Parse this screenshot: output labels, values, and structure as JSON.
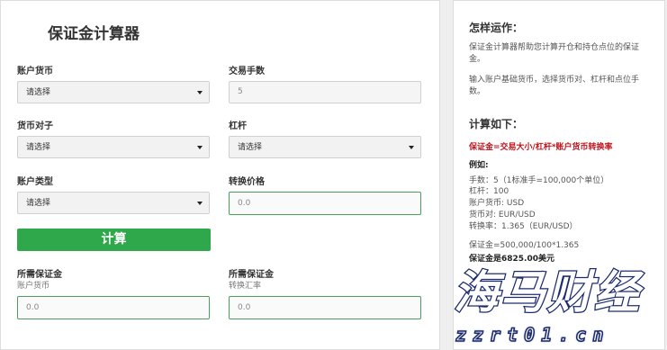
{
  "calculator": {
    "title": "保证金计算器",
    "account_currency_label": "账户货币",
    "account_currency_value": "请选择",
    "trade_size_label": "交易手数",
    "trade_size_value": "5",
    "currency_pair_label": "货币对子",
    "currency_pair_value": "请选择",
    "leverage_label": "杠杆",
    "leverage_value": "请选择",
    "account_type_label": "账户类型",
    "account_type_value": "请选择",
    "conversion_price_label": "转换价格",
    "conversion_price_value": "0.0",
    "calculate_button": "计算",
    "result1_label": "所需保证金",
    "result1_sublabel": "账户货币",
    "result1_value": "0.0",
    "result2_label": "所需保证金",
    "result2_sublabel": "转换汇率",
    "result2_value": "0.0"
  },
  "help": {
    "how_title": "怎样运作：",
    "how_p1": "保证金计算器帮助您计算开仓和持仓点位的保证金。",
    "how_p2": "输入账户基础货币，选择货币对、杠杆和点位手数。",
    "calc_title": "计算如下：",
    "formula": "保证金=交易大小/杠杆*账户货币转换率",
    "example_label": "例如:",
    "example_lines": [
      "手数：5（1标准手=100,000个单位）",
      "杠杆：100",
      "账户货币: USD",
      "货币对: EUR/USD",
      "转换率：1.365（EUR/USD）"
    ],
    "example_calc": "保证金=500,000/100*1.365",
    "example_result": "保证金是6825.00美元"
  },
  "watermark": {
    "brand_text": "海马财经",
    "url_text": "zzrt01.cn",
    "color": "#1a2a6c"
  }
}
